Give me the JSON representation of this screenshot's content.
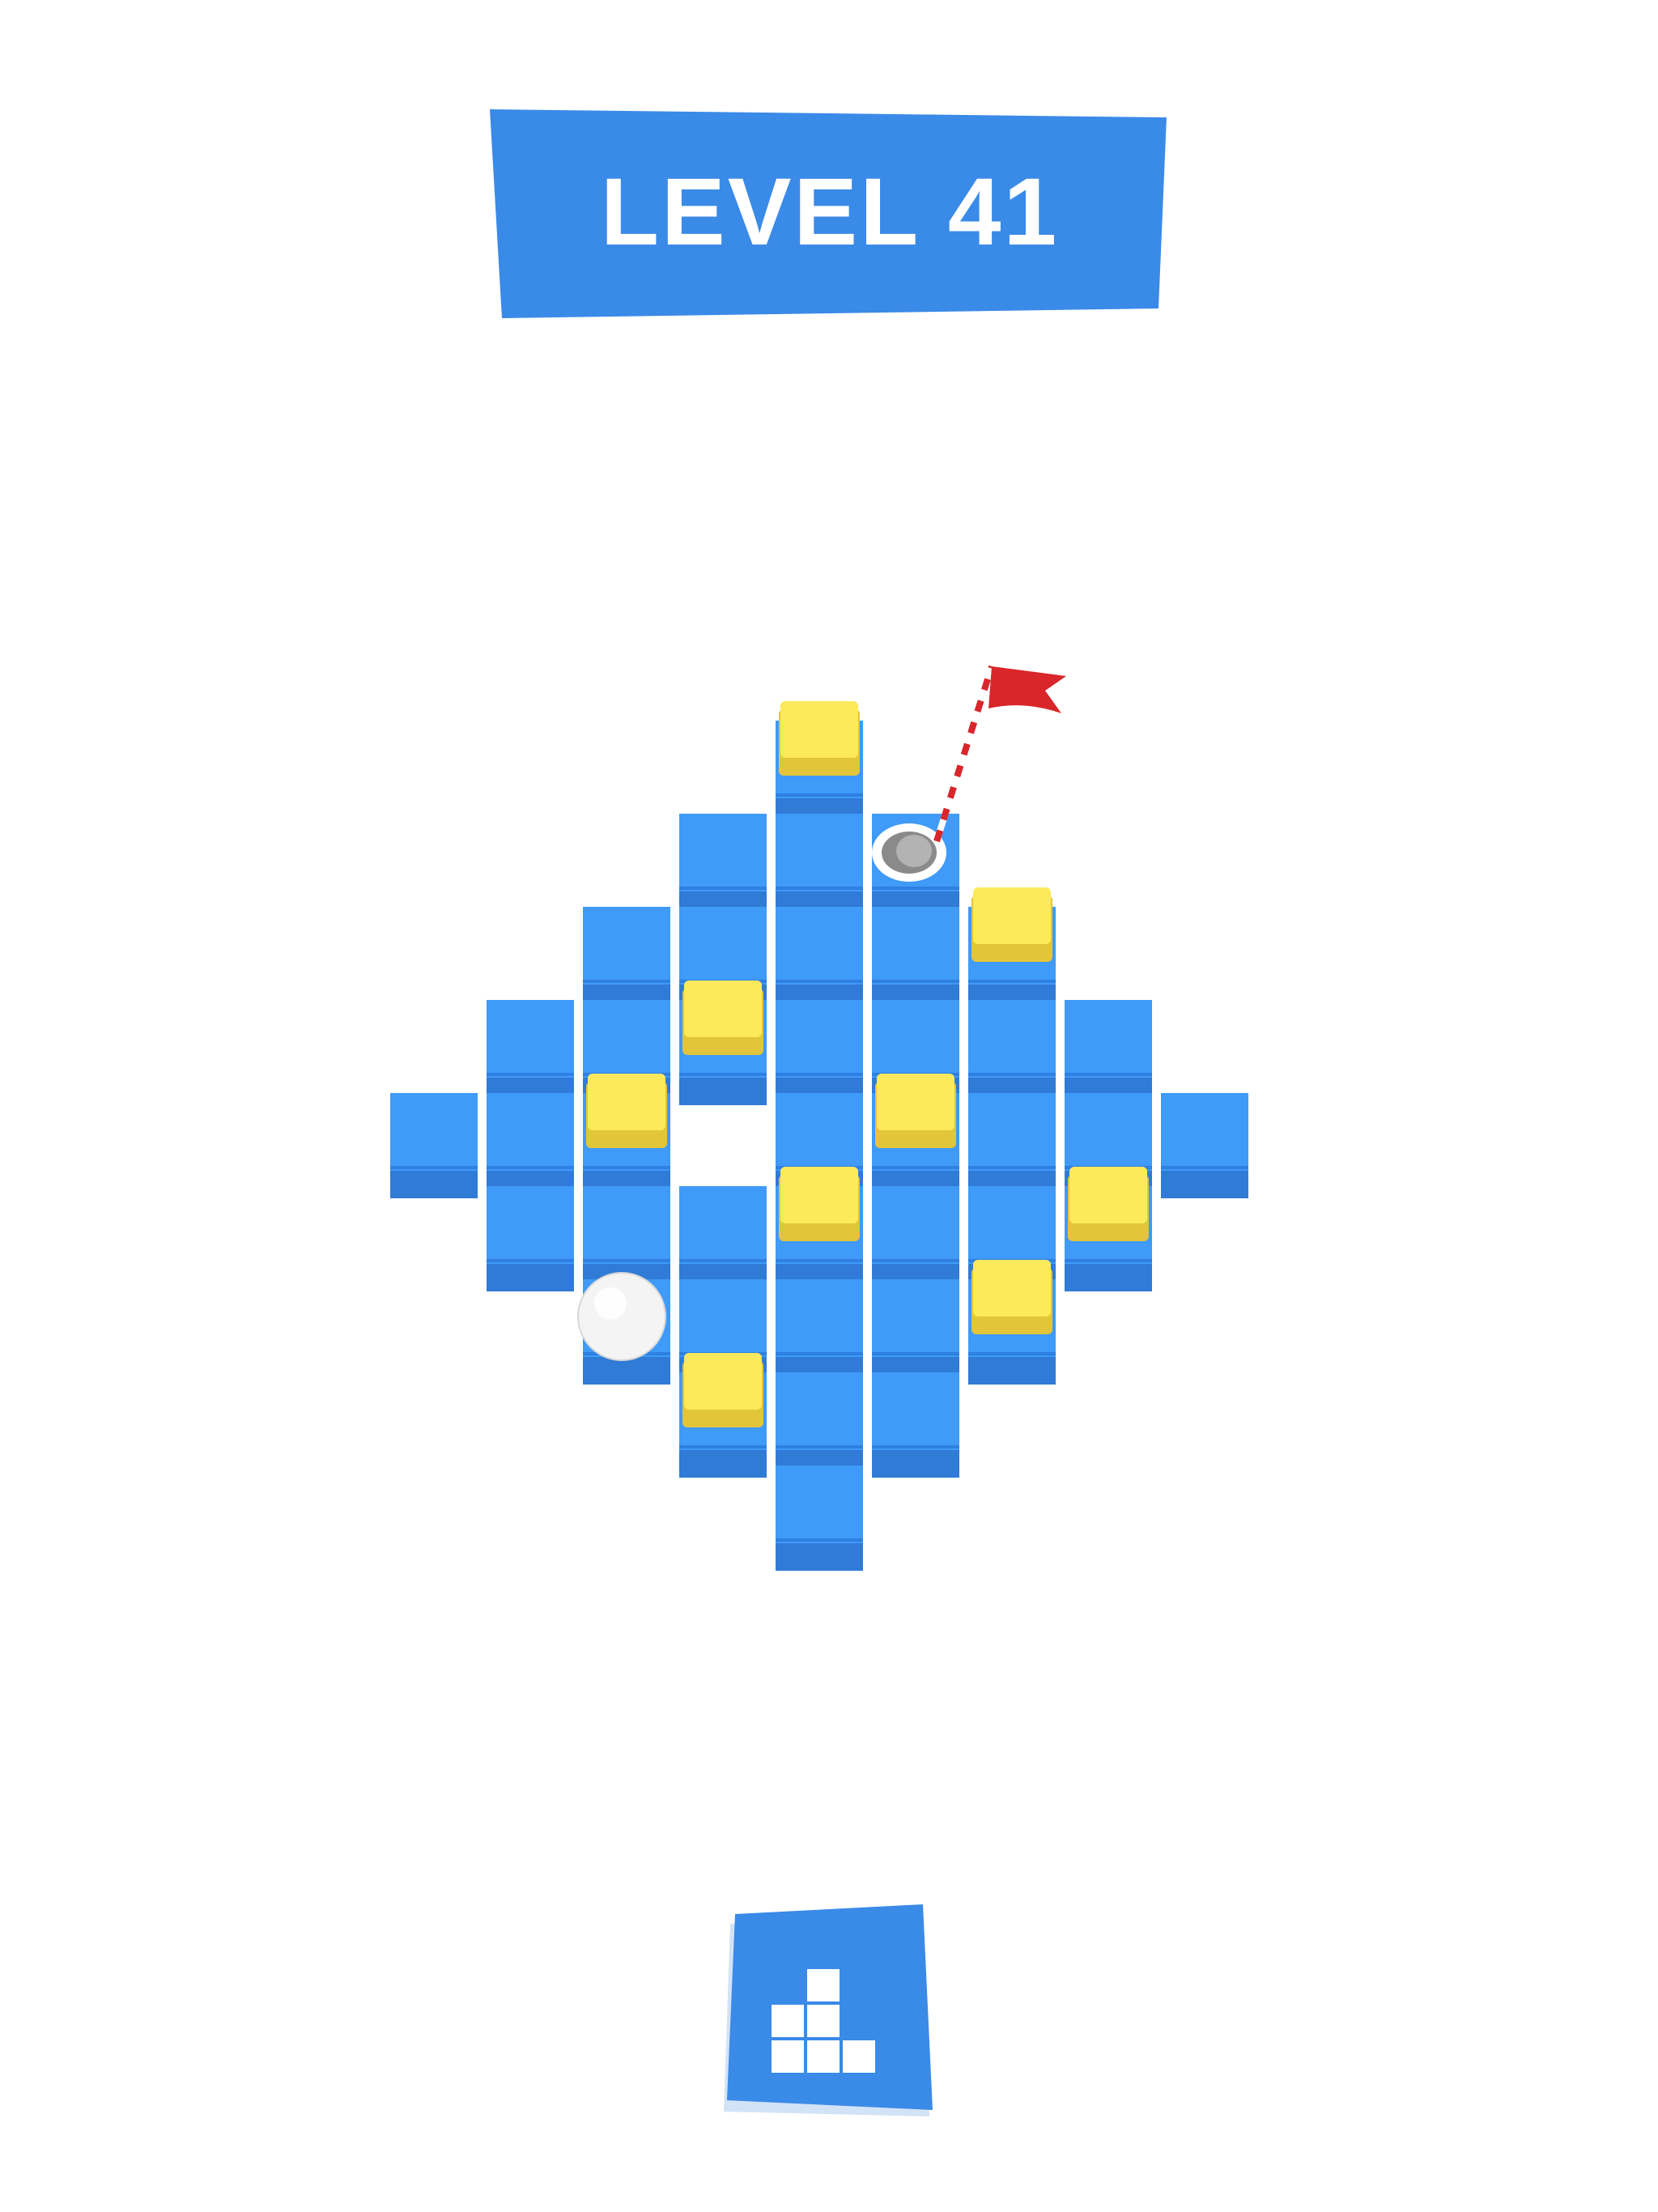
{
  "header": {
    "level_label": "LEVEL 41"
  },
  "board": {
    "tiles": [
      {
        "row": 0,
        "col": 4,
        "type": "yellow"
      },
      {
        "row": 1,
        "col": 3,
        "type": "blue"
      },
      {
        "row": 1,
        "col": 4,
        "type": "blue"
      },
      {
        "row": 1,
        "col": 5,
        "type": "hole"
      },
      {
        "row": 2,
        "col": 2,
        "type": "blue"
      },
      {
        "row": 2,
        "col": 3,
        "type": "blue"
      },
      {
        "row": 2,
        "col": 4,
        "type": "blue"
      },
      {
        "row": 2,
        "col": 5,
        "type": "blue"
      },
      {
        "row": 2,
        "col": 6,
        "type": "yellow"
      },
      {
        "row": 3,
        "col": 1,
        "type": "blue"
      },
      {
        "row": 3,
        "col": 2,
        "type": "blue"
      },
      {
        "row": 3,
        "col": 3,
        "type": "yellow"
      },
      {
        "row": 3,
        "col": 4,
        "type": "blue"
      },
      {
        "row": 3,
        "col": 5,
        "type": "blue"
      },
      {
        "row": 3,
        "col": 6,
        "type": "blue"
      },
      {
        "row": 3,
        "col": 7,
        "type": "blue"
      },
      {
        "row": 4,
        "col": 0,
        "type": "blue"
      },
      {
        "row": 4,
        "col": 1,
        "type": "blue"
      },
      {
        "row": 4,
        "col": 2,
        "type": "yellow"
      },
      {
        "row": 4,
        "col": 4,
        "type": "blue"
      },
      {
        "row": 4,
        "col": 5,
        "type": "yellow"
      },
      {
        "row": 4,
        "col": 6,
        "type": "blue"
      },
      {
        "row": 4,
        "col": 7,
        "type": "blue"
      },
      {
        "row": 4,
        "col": 8,
        "type": "blue"
      },
      {
        "row": 5,
        "col": 1,
        "type": "blue"
      },
      {
        "row": 5,
        "col": 2,
        "type": "blue"
      },
      {
        "row": 5,
        "col": 3,
        "type": "blue"
      },
      {
        "row": 5,
        "col": 4,
        "type": "yellow"
      },
      {
        "row": 5,
        "col": 5,
        "type": "blue"
      },
      {
        "row": 5,
        "col": 6,
        "type": "blue"
      },
      {
        "row": 5,
        "col": 7,
        "type": "yellow"
      },
      {
        "row": 6,
        "col": 2,
        "type": "ball"
      },
      {
        "row": 6,
        "col": 3,
        "type": "blue"
      },
      {
        "row": 6,
        "col": 4,
        "type": "blue"
      },
      {
        "row": 6,
        "col": 5,
        "type": "blue"
      },
      {
        "row": 6,
        "col": 6,
        "type": "yellow"
      },
      {
        "row": 7,
        "col": 3,
        "type": "yellow"
      },
      {
        "row": 7,
        "col": 4,
        "type": "blue"
      },
      {
        "row": 7,
        "col": 5,
        "type": "blue"
      },
      {
        "row": 8,
        "col": 4,
        "type": "blue"
      }
    ]
  },
  "colors": {
    "accent": "#3a8ae8",
    "accent_shadow": "#d2e3f8",
    "tile_top": "#3f9af8",
    "tile_side": "#2f7bd6",
    "tile_yellow": "#fde95c",
    "tile_yellow_side": "#e2c53a",
    "flag": "#d8262a",
    "background": "#ffffff"
  },
  "icons": {
    "levels_button": "bar-chart-blocks-icon",
    "flag": "golf-flag-icon",
    "ball": "golf-ball-icon",
    "hole": "golf-hole-icon"
  }
}
